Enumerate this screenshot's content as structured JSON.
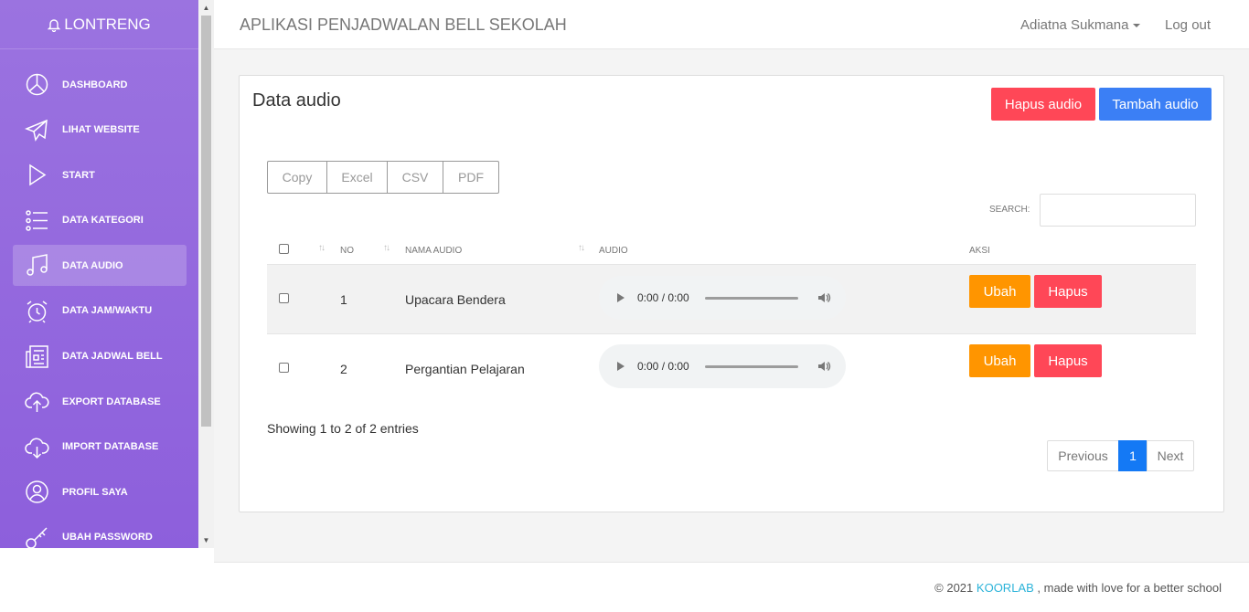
{
  "brand": {
    "name": "LONTRENG",
    "icon": "bell-icon"
  },
  "sidebar": {
    "items": [
      {
        "label": "DASHBOARD",
        "icon": "pie-chart-icon",
        "active": false
      },
      {
        "label": "LIHAT WEBSITE",
        "icon": "send-icon",
        "active": false
      },
      {
        "label": "START",
        "icon": "play-icon",
        "active": false
      },
      {
        "label": "DATA KATEGORI",
        "icon": "list-icon",
        "active": false
      },
      {
        "label": "DATA AUDIO",
        "icon": "music-icon",
        "active": true
      },
      {
        "label": "DATA JAM/WAKTU",
        "icon": "alarm-clock-icon",
        "active": false
      },
      {
        "label": "DATA JADWAL BELL",
        "icon": "newspaper-icon",
        "active": false
      },
      {
        "label": "EXPORT DATABASE",
        "icon": "cloud-upload-icon",
        "active": false
      },
      {
        "label": "IMPORT DATABASE",
        "icon": "cloud-download-icon",
        "active": false
      },
      {
        "label": "PROFIL SAYA",
        "icon": "user-icon",
        "active": false
      },
      {
        "label": "UBAH PASSWORD",
        "icon": "key-icon",
        "active": false
      }
    ]
  },
  "header": {
    "title": "APLIKASI PENJADWALAN BELL SEKOLAH",
    "user": "Adiatna Sukmana",
    "logout": "Log out"
  },
  "main": {
    "title": "Data audio",
    "hapus_audio_label": "Hapus audio",
    "tambah_audio_label": "Tambah audio",
    "export_buttons": [
      "Copy",
      "Excel",
      "CSV",
      "PDF"
    ],
    "search_label": "SEARCH:",
    "search_value": "",
    "columns": {
      "no": "NO",
      "nama": "NAMA AUDIO",
      "audio": "AUDIO",
      "aksi": "AKSI"
    },
    "rows": [
      {
        "no": "1",
        "nama": "Upacara Bendera",
        "time": "0:00 / 0:00",
        "ubah": "Ubah",
        "hapus": "Hapus"
      },
      {
        "no": "2",
        "nama": "Pergantian Pelajaran",
        "time": "0:00 / 0:00",
        "ubah": "Ubah",
        "hapus": "Hapus"
      }
    ],
    "info": "Showing 1 to 2 of 2 entries",
    "pagination": {
      "previous": "Previous",
      "current": "1",
      "next": "Next"
    }
  },
  "footer": {
    "prefix": "© 2021",
    "link": "KOORLAB",
    "suffix": ", made with love for a better school"
  },
  "colors": {
    "sidebar": "#9b73e0",
    "danger": "#ff4757",
    "primary": "#3b7ff5",
    "warning": "#ff9500",
    "page_active": "#1479f5",
    "footer_link": "#2bb3d9"
  }
}
